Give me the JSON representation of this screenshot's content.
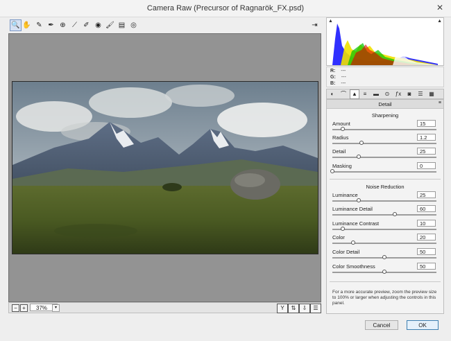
{
  "window": {
    "title": "Camera Raw (Precursor of Ragnarök_FX.psd)",
    "close_glyph": "✕"
  },
  "toolbar": {
    "tools": [
      {
        "icon": "zoom-tool-icon",
        "glyph": "🔍"
      },
      {
        "icon": "hand-tool-icon",
        "glyph": "✋"
      },
      {
        "icon": "white-balance-tool-icon",
        "glyph": "✎"
      },
      {
        "icon": "color-sampler-tool-icon",
        "glyph": "✒"
      },
      {
        "icon": "targeted-adjustment-tool-icon",
        "glyph": "⊕"
      },
      {
        "icon": "straighten-tool-icon",
        "glyph": "⟋"
      },
      {
        "icon": "spot-removal-tool-icon",
        "glyph": "✐"
      },
      {
        "icon": "red-eye-tool-icon",
        "glyph": "◉"
      },
      {
        "icon": "adjustment-brush-icon",
        "glyph": "🖌"
      },
      {
        "icon": "graduated-filter-icon",
        "glyph": "▤"
      },
      {
        "icon": "radial-filter-icon",
        "glyph": "◎"
      }
    ],
    "exit_glyph": "⇥"
  },
  "histogram": {
    "left_clip_glyph": "▲",
    "right_clip_glyph": "▲"
  },
  "rgb_readout": [
    {
      "label": "R:",
      "value": "---"
    },
    {
      "label": "G:",
      "value": "---"
    },
    {
      "label": "B:",
      "value": "---"
    }
  ],
  "panel_tabs": [
    {
      "icon": "basic-tab-icon",
      "glyph": "◐"
    },
    {
      "icon": "tone-curve-tab-icon",
      "glyph": "⌒"
    },
    {
      "icon": "detail-tab-icon",
      "glyph": "▲"
    },
    {
      "icon": "hsl-tab-icon",
      "glyph": "≡"
    },
    {
      "icon": "split-toning-tab-icon",
      "glyph": "▬"
    },
    {
      "icon": "lens-corrections-tab-icon",
      "glyph": "⊙"
    },
    {
      "icon": "effects-tab-icon",
      "glyph": "ƒx"
    },
    {
      "icon": "camera-calibration-tab-icon",
      "glyph": "◙"
    },
    {
      "icon": "presets-tab-icon",
      "glyph": "☰"
    },
    {
      "icon": "snapshots-tab-icon",
      "glyph": "▦"
    }
  ],
  "panel": {
    "title": "Detail",
    "menu_glyph": "≡",
    "sharpening": {
      "title": "Sharpening",
      "sliders": [
        {
          "label": "Amount",
          "value": "15",
          "fraction": 0.1
        },
        {
          "label": "Radius",
          "value": "1.2",
          "fraction": 0.28
        },
        {
          "label": "Detail",
          "value": "25",
          "fraction": 0.25
        },
        {
          "label": "Masking",
          "value": "0",
          "fraction": 0.0
        }
      ]
    },
    "noise": {
      "title": "Noise Reduction",
      "sliders": [
        {
          "label": "Luminance",
          "value": "25",
          "fraction": 0.25
        },
        {
          "label": "Luminance Detail",
          "value": "60",
          "fraction": 0.6
        },
        {
          "label": "Luminance Contrast",
          "value": "10",
          "fraction": 0.1
        },
        {
          "label": "Color",
          "value": "20",
          "fraction": 0.2
        },
        {
          "label": "Color Detail",
          "value": "50",
          "fraction": 0.5
        },
        {
          "label": "Color Smoothness",
          "value": "50",
          "fraction": 0.5
        }
      ]
    },
    "note": "For a more accurate preview, zoom the preview size to 100% or larger when adjusting the controls in this panel."
  },
  "status": {
    "zoom_out_glyph": "−",
    "zoom_in_glyph": "+",
    "zoom_value": "37%",
    "zoom_arrow": "▾",
    "view_buttons": [
      {
        "icon": "before-after-view-icon",
        "glyph": "Y"
      },
      {
        "icon": "swap-settings-icon",
        "glyph": "⇅"
      },
      {
        "icon": "copy-settings-icon",
        "glyph": "⇩"
      },
      {
        "icon": "toggle-settings-icon",
        "glyph": "☰"
      }
    ]
  },
  "buttons": {
    "cancel": "Cancel",
    "ok": "OK"
  }
}
